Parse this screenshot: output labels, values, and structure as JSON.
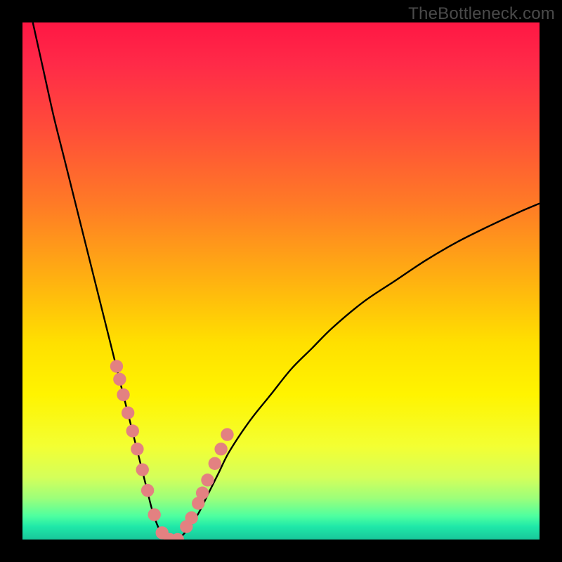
{
  "watermark": "TheBottleneck.com",
  "colors": {
    "black": "#000000",
    "curve": "#000000",
    "marker_fill": "#e38181",
    "marker_stroke": "#b85a5a",
    "gradient": [
      {
        "stop": 0.0,
        "hex": "#ff1744"
      },
      {
        "stop": 0.08,
        "hex": "#ff2a48"
      },
      {
        "stop": 0.2,
        "hex": "#ff4b3a"
      },
      {
        "stop": 0.35,
        "hex": "#ff7a26"
      },
      {
        "stop": 0.5,
        "hex": "#ffb210"
      },
      {
        "stop": 0.62,
        "hex": "#ffe000"
      },
      {
        "stop": 0.72,
        "hex": "#fff400"
      },
      {
        "stop": 0.82,
        "hex": "#f3ff33"
      },
      {
        "stop": 0.88,
        "hex": "#d4ff5a"
      },
      {
        "stop": 0.92,
        "hex": "#9dff7a"
      },
      {
        "stop": 0.955,
        "hex": "#4dffa0"
      },
      {
        "stop": 0.975,
        "hex": "#1fe8a8"
      },
      {
        "stop": 1.0,
        "hex": "#18c79b"
      }
    ]
  },
  "chart_data": {
    "type": "line",
    "title": "",
    "xlabel": "",
    "ylabel": "",
    "xlim": [
      0,
      100
    ],
    "ylim": [
      0,
      100
    ],
    "grid": false,
    "legend": false,
    "series": [
      {
        "name": "bottleneck-curve",
        "x": [
          2,
          4,
          6,
          8,
          10,
          12,
          14,
          16,
          18,
          19,
          20,
          21,
          22,
          23,
          24,
          25,
          26,
          27,
          28,
          29,
          30,
          32,
          34,
          36,
          38,
          40,
          44,
          48,
          52,
          56,
          60,
          66,
          72,
          78,
          84,
          90,
          96,
          100
        ],
        "y": [
          100,
          91,
          82,
          74,
          66,
          58,
          50,
          42,
          34,
          30,
          26,
          22,
          18,
          14,
          10,
          6,
          3,
          1,
          0,
          0,
          0,
          2,
          5,
          9,
          13,
          17,
          23,
          28,
          33,
          37,
          41,
          46,
          50,
          54,
          57.5,
          60.5,
          63.3,
          65
        ]
      }
    ],
    "markers": {
      "name": "highlight-dots",
      "x": [
        18.2,
        18.8,
        19.5,
        20.4,
        21.3,
        22.2,
        23.2,
        24.2,
        25.5,
        27.0,
        28.5,
        30.0,
        31.7,
        32.7,
        34.0,
        34.8,
        35.8,
        37.2,
        38.4,
        39.6
      ],
      "y": [
        33.5,
        31.0,
        28.0,
        24.5,
        21.0,
        17.5,
        13.5,
        9.5,
        4.8,
        1.3,
        0.0,
        0.0,
        2.5,
        4.2,
        7.0,
        9.0,
        11.5,
        14.7,
        17.5,
        20.3
      ]
    }
  }
}
